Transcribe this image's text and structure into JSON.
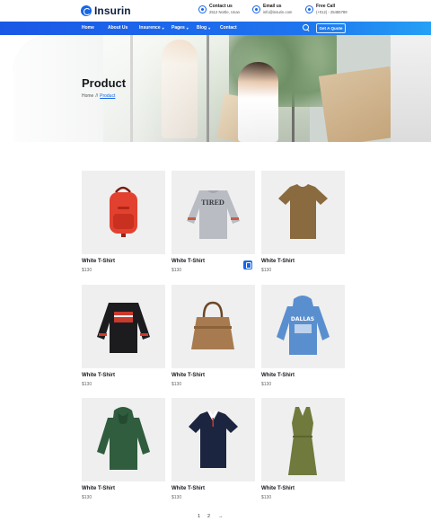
{
  "brand": {
    "name": "Insurin"
  },
  "header_info": [
    {
      "title": "Contact us",
      "value": "2512 Nortle, Unan"
    },
    {
      "title": "Email us",
      "value": "info@insurin.com"
    },
    {
      "title": "Free Call",
      "value": "(+012) - 25486789"
    }
  ],
  "nav": {
    "items": [
      "Home",
      "About Us",
      "Insurence",
      "Pages",
      "Blog",
      "Contact"
    ],
    "quote_button": "Get A Quote"
  },
  "hero": {
    "title": "Product",
    "breadcrumb_home": "Home",
    "breadcrumb_sep": "//",
    "breadcrumb_current": "Product"
  },
  "products": [
    {
      "name": "White T-Shirt",
      "price": "$130",
      "image": "red-backpack"
    },
    {
      "name": "White T-Shirt",
      "price": "$130",
      "image": "grey-tired-sweatshirt"
    },
    {
      "name": "White T-Shirt",
      "price": "$130",
      "image": "brown-tshirt"
    },
    {
      "name": "White T-Shirt",
      "price": "$130",
      "image": "black-printed-sweatshirt"
    },
    {
      "name": "White T-Shirt",
      "price": "$130",
      "image": "brown-tote-bag"
    },
    {
      "name": "White T-Shirt",
      "price": "$130",
      "image": "blue-dallas-hoodie"
    },
    {
      "name": "White T-Shirt",
      "price": "$130",
      "image": "green-hoodie"
    },
    {
      "name": "White T-Shirt",
      "price": "$130",
      "image": "navy-polo-shirt"
    },
    {
      "name": "White T-Shirt",
      "price": "$130",
      "image": "olive-sleeveless-dress"
    }
  ],
  "pagination": {
    "pages": [
      "1",
      "2"
    ],
    "next": "→"
  },
  "colors": {
    "accent": "#1766e8",
    "nav_start": "#1a57e6",
    "nav_end": "#25a0f5",
    "card_bg": "#efefef"
  }
}
